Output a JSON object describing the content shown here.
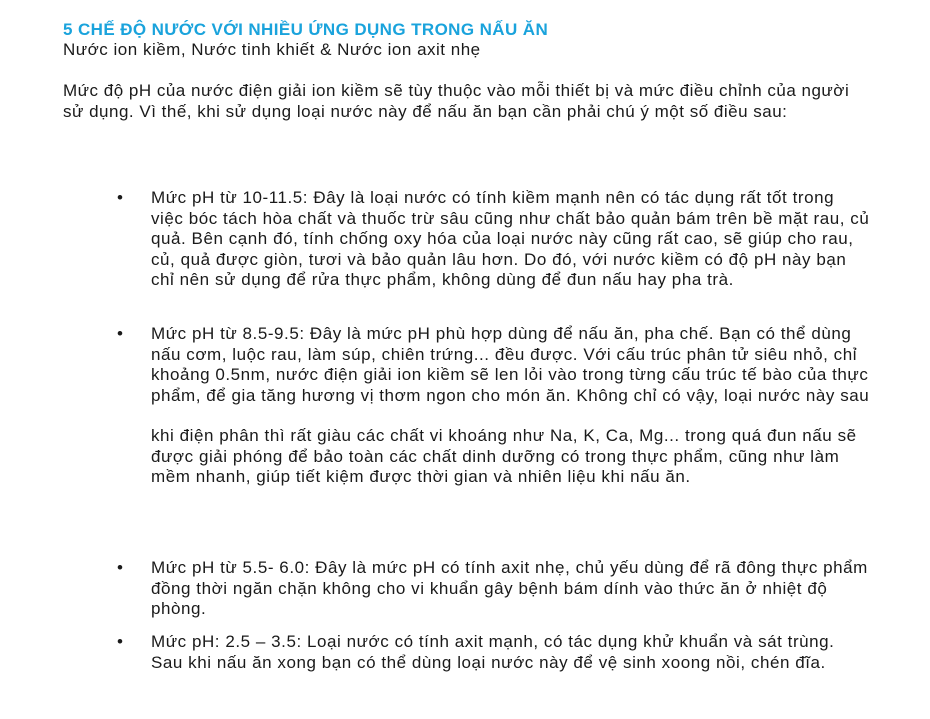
{
  "heading": "5 CHẾ ĐỘ NƯỚC VỚI NHIỀU ỨNG DỤNG TRONG NẤU ĂN",
  "subheading": "Nước ion kiềm, Nước tinh khiết & Nước ion axit nhẹ",
  "intro": "Mức độ pH của nước điện giải ion kiềm sẽ tùy thuộc vào mỗi thiết bị và mức điều chỉnh của người sử dụng. Vì thế, khi sử dụng loại nước này để nấu ăn bạn cần phải chú ý một số điều sau:",
  "bullet_symbol": "•",
  "items": [
    {
      "text": "Mức pH từ 10-11.5: Đây là loại nước có tính kiềm mạnh nên có tác dụng rất tốt trong việc bóc tách hòa chất và thuốc trừ sâu cũng như chất bảo quản bám trên bề mặt rau, củ quả. Bên cạnh đó, tính chống oxy hóa của loại nước này cũng rất cao, sẽ giúp cho rau, củ, quả được giòn, tươi và bảo quản lâu hơn. Do đó, với nước kiềm có độ pH này bạn chỉ nên sử dụng để rửa thực phẩm, không dùng để đun nấu hay pha trà."
    },
    {
      "text": "Mức pH từ 8.5-9.5: Đây là mức pH phù hợp dùng để nấu ăn, pha chế. Bạn có thể dùng nấu cơm, luộc rau, làm súp, chiên trứng... đều được. Với cấu trúc phân tử siêu nhỏ, chỉ  khoảng 0.5nm, nước điện giải ion kiềm sẽ len lỏi vào trong từng cấu trúc tế bào của thực phẩm, để gia tăng hương vị thơm ngon cho món ăn. Không chỉ có vậy, loại nước này sau",
      "continuation": "khi điện phân thì rất giàu các chất vi khoáng như Na, K, Ca, Mg... trong quá đun nấu sẽ được giải phóng để bảo toàn các chất dinh dưỡng có trong thực phẩm, cũng như làm mềm nhanh, giúp tiết kiệm được thời gian và nhiên liệu khi nấu ăn."
    },
    {
      "text": "Mức pH từ 5.5- 6.0: Đây là mức pH có tính axit nhẹ, chủ yếu dùng để rã đông thực phẩm đồng thời ngăn chặn không cho vi khuẩn gây bệnh bám dính vào thức ăn ở nhiệt độ phòng."
    },
    {
      "text": "Mức pH: 2.5 – 3.5: Loại nước có tính axit mạnh, có tác dụng khử khuẩn và sát trùng. Sau khi nấu ăn xong bạn có thể dùng loại nước này để vệ sinh xoong nồi, chén đĩa."
    }
  ]
}
